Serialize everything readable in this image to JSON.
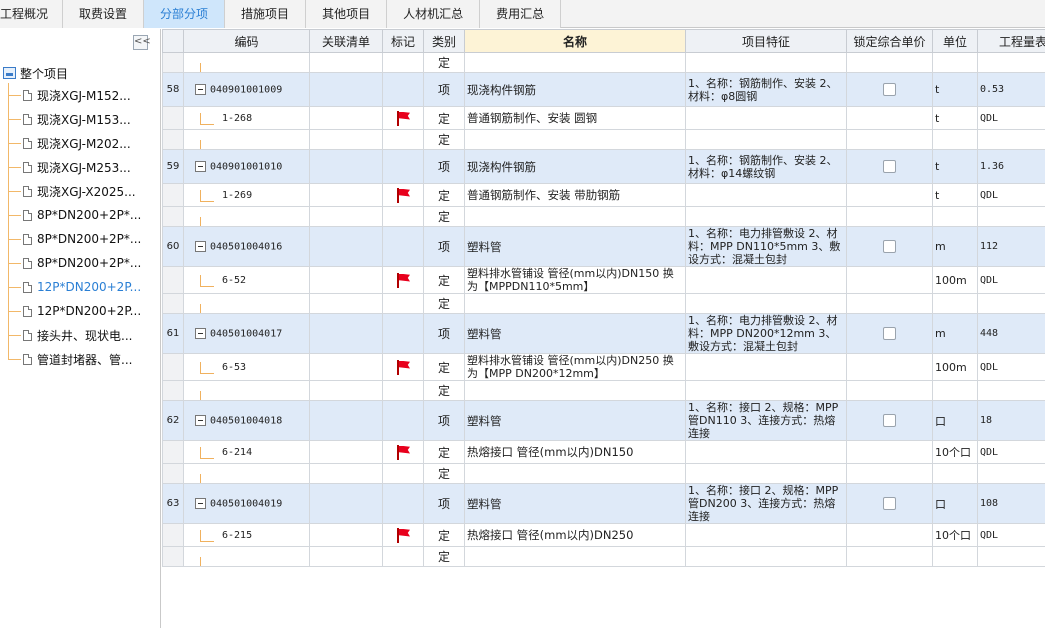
{
  "tabs": [
    "工程概况",
    "取费设置",
    "分部分项",
    "措施项目",
    "其他项目",
    "人材机汇总",
    "费用汇总"
  ],
  "active_tab": 2,
  "left_panel": {
    "collapse_glyph": "<<",
    "root_label": "整个项目",
    "items": [
      {
        "label": "现浇XGJ-M152..."
      },
      {
        "label": "现浇XGJ-M153..."
      },
      {
        "label": "现浇XGJ-M202..."
      },
      {
        "label": "现浇XGJ-M253..."
      },
      {
        "label": "现浇XGJ-X2025..."
      },
      {
        "label": "8P*DN200+2P*..."
      },
      {
        "label": "8P*DN200+2P*..."
      },
      {
        "label": "8P*DN200+2P*..."
      },
      {
        "label": "12P*DN200+2P..."
      },
      {
        "label": "12P*DN200+2P..."
      },
      {
        "label": "接头井、现状电..."
      },
      {
        "label": "管道封堵器、管..."
      }
    ],
    "selected_index": 8
  },
  "grid": {
    "headers": {
      "code": "编码",
      "linked": "关联清单",
      "mark": "标记",
      "category": "类别",
      "name": "名称",
      "features": "项目特征",
      "lock_price": "锁定综合单价",
      "unit": "单位",
      "quantity": "工程量表"
    },
    "rows": [
      {
        "kind": "blank",
        "num": "",
        "code": "",
        "category": "定",
        "name": "",
        "features": "",
        "unit": "",
        "qty": "",
        "flag": false
      },
      {
        "kind": "item",
        "num": "58",
        "code": "040901001009",
        "category": "项",
        "name": "现浇构件钢筋",
        "features": "1、名称：钢筋制作、安装 2、材料：φ8圆钢",
        "unit": "t",
        "qty": "0.53",
        "flag": false
      },
      {
        "kind": "sub",
        "num": "",
        "code": "1-268",
        "category": "定",
        "name": "普通钢筋制作、安装 圆钢",
        "features": "",
        "unit": "t",
        "qty": "QDL",
        "flag": true
      },
      {
        "kind": "blank",
        "num": "",
        "code": "",
        "category": "定",
        "name": "",
        "features": "",
        "unit": "",
        "qty": "",
        "flag": false
      },
      {
        "kind": "item",
        "num": "59",
        "code": "040901001010",
        "category": "项",
        "name": "现浇构件钢筋",
        "features": "1、名称：钢筋制作、安装 2、材料：φ14螺纹钢",
        "unit": "t",
        "qty": "1.36",
        "flag": false
      },
      {
        "kind": "sub",
        "num": "",
        "code": "1-269",
        "category": "定",
        "name": "普通钢筋制作、安装 带肋钢筋",
        "features": "",
        "unit": "t",
        "qty": "QDL",
        "flag": true
      },
      {
        "kind": "blank",
        "num": "",
        "code": "",
        "category": "定",
        "name": "",
        "features": "",
        "unit": "",
        "qty": "",
        "flag": false
      },
      {
        "kind": "item",
        "num": "60",
        "code": "040501004016",
        "category": "项",
        "name": "塑料管",
        "features": "1、名称：电力排管敷设 2、材料：MPP DN110*5mm 3、敷设方式：混凝土包封",
        "unit": "m",
        "qty": "112",
        "flag": false
      },
      {
        "kind": "sub",
        "num": "",
        "code": "6-52",
        "category": "定",
        "name": "塑料排水管铺设 管径(mm以内)DN150 换为【MPPDN110*5mm】",
        "features": "",
        "unit": "100m",
        "qty": "QDL",
        "flag": true
      },
      {
        "kind": "blank",
        "num": "",
        "code": "",
        "category": "定",
        "name": "",
        "features": "",
        "unit": "",
        "qty": "",
        "flag": false
      },
      {
        "kind": "item",
        "num": "61",
        "code": "040501004017",
        "category": "项",
        "name": "塑料管",
        "features": "1、名称：电力排管敷设 2、材料：MPP DN200*12mm 3、敷设方式：混凝土包封",
        "unit": "m",
        "qty": "448",
        "flag": false
      },
      {
        "kind": "sub",
        "num": "",
        "code": "6-53",
        "category": "定",
        "name": "塑料排水管铺设 管径(mm以内)DN250 换为【MPP DN200*12mm】",
        "features": "",
        "unit": "100m",
        "qty": "QDL",
        "flag": true
      },
      {
        "kind": "blank",
        "num": "",
        "code": "",
        "category": "定",
        "name": "",
        "features": "",
        "unit": "",
        "qty": "",
        "flag": false
      },
      {
        "kind": "item",
        "num": "62",
        "code": "040501004018",
        "category": "项",
        "name": "塑料管",
        "features": "1、名称：接口 2、规格：MPP管DN110 3、连接方式：热熔连接",
        "unit": "口",
        "qty": "18",
        "flag": false
      },
      {
        "kind": "sub",
        "num": "",
        "code": "6-214",
        "category": "定",
        "name": "热熔接口 管径(mm以内)DN150",
        "features": "",
        "unit": "10个口",
        "qty": "QDL",
        "flag": true
      },
      {
        "kind": "blank",
        "num": "",
        "code": "",
        "category": "定",
        "name": "",
        "features": "",
        "unit": "",
        "qty": "",
        "flag": false
      },
      {
        "kind": "item",
        "num": "63",
        "code": "040501004019",
        "category": "项",
        "name": "塑料管",
        "features": "1、名称：接口 2、规格：MPP管DN200 3、连接方式：热熔连接",
        "unit": "口",
        "qty": "108",
        "flag": false
      },
      {
        "kind": "sub",
        "num": "",
        "code": "6-215",
        "category": "定",
        "name": "热熔接口 管径(mm以内)DN250",
        "features": "",
        "unit": "10个口",
        "qty": "QDL",
        "flag": true
      },
      {
        "kind": "blank",
        "num": "",
        "code": "",
        "category": "定",
        "name": "",
        "features": "",
        "unit": "",
        "qty": "",
        "flag": false
      }
    ]
  }
}
